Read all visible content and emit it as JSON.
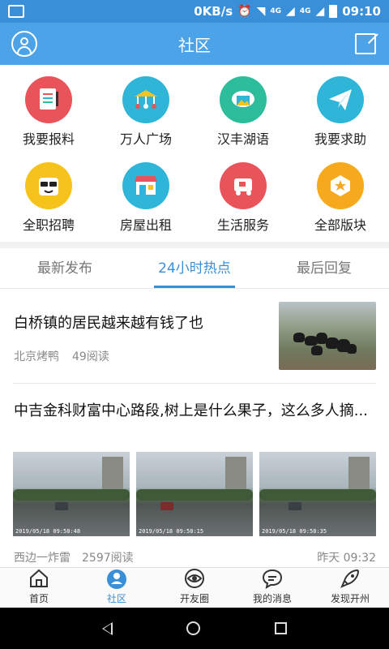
{
  "status_bar": {
    "network_speed": "0KB/s",
    "signal_1": "4G",
    "signal_2": "4G",
    "clock": "09:10"
  },
  "header": {
    "title": "社区"
  },
  "grid": [
    {
      "label": "我要报料",
      "icon": "clipboard-icon",
      "color": "#e8545a"
    },
    {
      "label": "万人广场",
      "icon": "carousel-icon",
      "color": "#2fb5d8"
    },
    {
      "label": "汉丰湖语",
      "icon": "photo-cloud-icon",
      "color": "#2ebd9b"
    },
    {
      "label": "我要求助",
      "icon": "paper-plane-icon",
      "color": "#2fb5d8"
    },
    {
      "label": "全职招聘",
      "icon": "smiley-icon",
      "color": "#f6c31c"
    },
    {
      "label": "房屋出租",
      "icon": "shop-icon",
      "color": "#2fb5d8"
    },
    {
      "label": "生活服务",
      "icon": "delivery-icon",
      "color": "#e8545a"
    },
    {
      "label": "全部版块",
      "icon": "star-badge-icon",
      "color": "#f6a91c"
    }
  ],
  "tabs": [
    {
      "label": "最新发布"
    },
    {
      "label": "24小时热点"
    },
    {
      "label": "最后回复"
    }
  ],
  "posts": [
    {
      "title": "白桥镇的居民越来越有钱了也",
      "author": "北京烤鸭",
      "reads": "49阅读"
    },
    {
      "title": "中吉金科财富中心路段,树上是什么果子，这么多人摘...",
      "author": "西边一炸雷",
      "reads": "2597阅读",
      "time": "昨天 09:32",
      "image_stamps": [
        "2019/05/18 09:58:48",
        "2019/05/18 09:58:15",
        "2019/05/18 09:58:35"
      ]
    }
  ],
  "tabbar": [
    {
      "label": "首页",
      "icon": "home-icon"
    },
    {
      "label": "社区",
      "icon": "community-icon"
    },
    {
      "label": "开友圈",
      "icon": "eye-icon"
    },
    {
      "label": "我的消息",
      "icon": "chat-bubble-icon"
    },
    {
      "label": "发现开州",
      "icon": "rocket-icon"
    }
  ],
  "colors": {
    "primary": "#4da3e8",
    "status_bar": "#3a8fd9",
    "active": "#3a8fd9"
  }
}
